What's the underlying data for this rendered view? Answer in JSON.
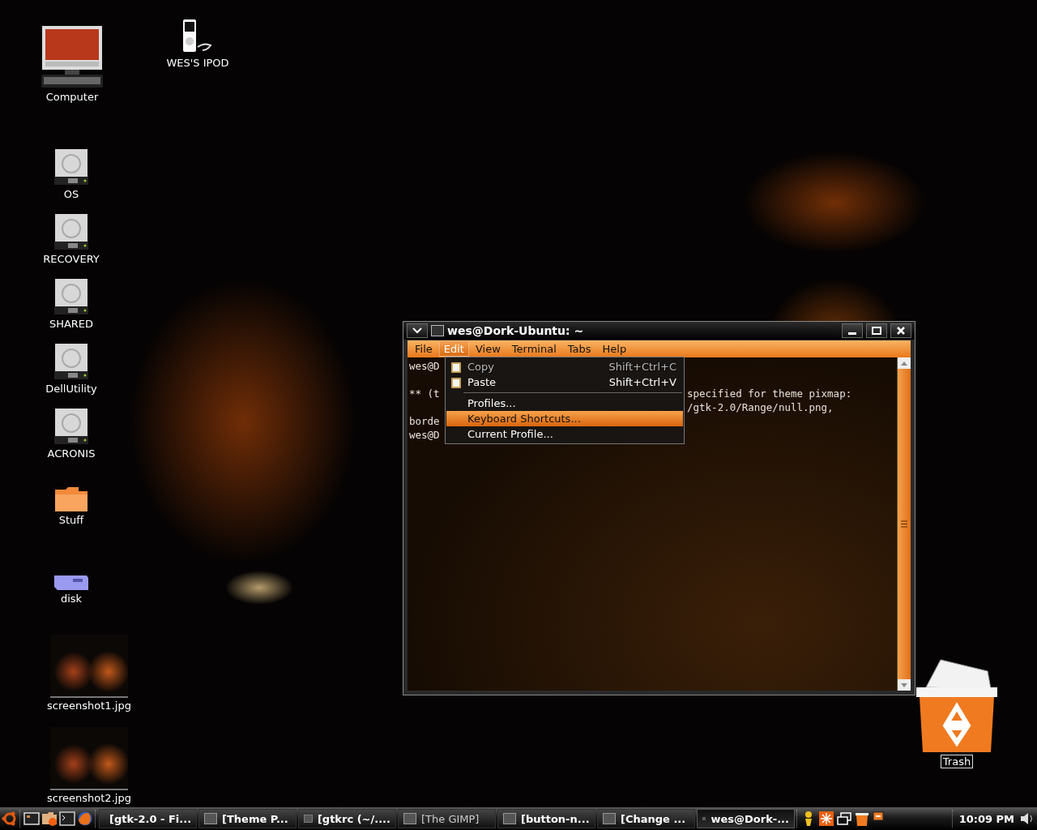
{
  "desktop_icons": [
    {
      "kind": "computer",
      "label": "Computer",
      "selected": false
    },
    {
      "kind": "player",
      "label": "WES'S IPOD",
      "selected": false
    },
    {
      "kind": "drive",
      "label": "OS",
      "selected": false
    },
    {
      "kind": "drive",
      "label": "RECOVERY",
      "selected": false
    },
    {
      "kind": "drive",
      "label": "SHARED",
      "selected": false
    },
    {
      "kind": "drive",
      "label": "DellUtility",
      "selected": false
    },
    {
      "kind": "drive",
      "label": "ACRONIS",
      "selected": false
    },
    {
      "kind": "folder",
      "label": "Stuff",
      "selected": false
    },
    {
      "kind": "card",
      "label": "disk",
      "selected": false
    },
    {
      "kind": "thumbnail",
      "label": "screenshot1.jpg",
      "selected": false
    },
    {
      "kind": "thumbnail",
      "label": "screenshot2.jpg",
      "selected": false
    },
    {
      "kind": "trash",
      "label": "Trash",
      "selected": true
    }
  ],
  "terminal_window": {
    "title": "wes@Dork-Ubuntu: ~",
    "menubar": [
      {
        "label": "File",
        "selected": false
      },
      {
        "label": "Edit",
        "selected": true
      },
      {
        "label": "View",
        "selected": false
      },
      {
        "label": "Terminal",
        "selected": false
      },
      {
        "label": "Tabs",
        "selected": false
      },
      {
        "label": "Help",
        "selected": false
      }
    ],
    "lines": [
      {
        "kind": "text",
        "left": "wes@D"
      },
      {
        "kind": "blank"
      },
      {
        "kind": "text",
        "left": "** (t",
        "right": "specified for theme pixmap:"
      },
      {
        "kind": "text",
        "right": "/gtk-2.0/Range/null.png,"
      },
      {
        "kind": "text",
        "left": "borde"
      },
      {
        "kind": "text",
        "left": "wes@D"
      }
    ],
    "edit_menu": [
      {
        "kind": "action",
        "label": "Copy",
        "shortcut": "Shift+Ctrl+C",
        "disabled": true,
        "selected": false
      },
      {
        "kind": "action",
        "label": "Paste",
        "shortcut": "Shift+Ctrl+V",
        "disabled": false,
        "selected": false
      },
      {
        "kind": "separator"
      },
      {
        "kind": "item",
        "label": "Profiles...",
        "disabled": false,
        "selected": false
      },
      {
        "kind": "item",
        "label": "Keyboard Shortcuts...",
        "disabled": false,
        "selected": true
      },
      {
        "kind": "item",
        "label": "Current Profile...",
        "disabled": false,
        "selected": false
      }
    ]
  },
  "taskbar": {
    "tasks": [
      {
        "label": "[gtk-2.0 - Fi...",
        "selected": false,
        "dimmed": false
      },
      {
        "label": "[Theme P...",
        "selected": false,
        "dimmed": false
      },
      {
        "label": "[gtkrc (~/....",
        "selected": false,
        "dimmed": false
      },
      {
        "label": "[The GIMP]",
        "selected": false,
        "dimmed": true
      },
      {
        "label": "[button-n...",
        "selected": false,
        "dimmed": false
      },
      {
        "label": "[Change ...",
        "selected": false,
        "dimmed": false
      },
      {
        "label": "wes@Dork-...",
        "selected": true,
        "dimmed": false
      }
    ],
    "clock": "10:09 PM"
  }
}
